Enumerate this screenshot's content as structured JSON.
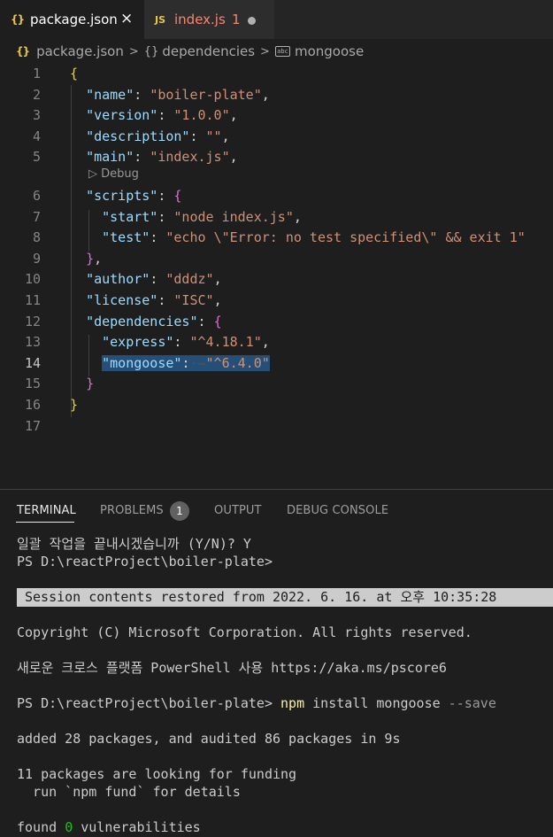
{
  "tabs": [
    {
      "icon": "{}",
      "label": "package.json",
      "close": "×"
    },
    {
      "icon": "JS",
      "label": "index.js",
      "problems": "1"
    }
  ],
  "breadcrumb": {
    "file": "package.json",
    "section": "dependencies",
    "item": "mongoose",
    "str_icon": "abc"
  },
  "editor": {
    "line_numbers": [
      "1",
      "2",
      "3",
      "4",
      "5",
      "6",
      "7",
      "8",
      "9",
      "10",
      "11",
      "12",
      "13",
      "14",
      "15",
      "16",
      "17"
    ],
    "codelens": "▷ Debug",
    "lines": {
      "l1": {
        "open": "{"
      },
      "l2": {
        "key": "\"name\"",
        "colon": ": ",
        "val": "\"boiler-plate\"",
        "comma": ","
      },
      "l3": {
        "key": "\"version\"",
        "colon": ": ",
        "val": "\"1.0.0\"",
        "comma": ","
      },
      "l4": {
        "key": "\"description\"",
        "colon": ": ",
        "val": "\"\"",
        "comma": ","
      },
      "l5": {
        "key": "\"main\"",
        "colon": ": ",
        "val": "\"index.js\"",
        "comma": ","
      },
      "l6": {
        "key": "\"scripts\"",
        "colon": ": ",
        "open": "{"
      },
      "l7": {
        "key": "\"start\"",
        "colon": ": ",
        "val": "\"node index.js\"",
        "comma": ","
      },
      "l8": {
        "key": "\"test\"",
        "colon": ": ",
        "val": "\"echo \\\"Error: no test specified\\\" && exit 1\""
      },
      "l9": {
        "close": "}",
        "comma": ","
      },
      "l10": {
        "key": "\"author\"",
        "colon": ": ",
        "val": "\"dddz\"",
        "comma": ","
      },
      "l11": {
        "key": "\"license\"",
        "colon": ": ",
        "val": "\"ISC\"",
        "comma": ","
      },
      "l12": {
        "key": "\"dependencies\"",
        "colon": ": ",
        "open": "{"
      },
      "l13": {
        "key": "\"express\"",
        "colon": ": ",
        "val": "\"^4.18.1\"",
        "comma": ","
      },
      "l14": {
        "key": "\"mongoose\"",
        "colon": ":",
        "val": "\"^6.4.0\""
      },
      "l15": {
        "close": "}"
      },
      "l16": {
        "close": "}"
      }
    }
  },
  "panel": {
    "tabs": [
      "TERMINAL",
      "PROBLEMS",
      "OUTPUT",
      "DEBUG CONSOLE"
    ],
    "problems_count": "1",
    "terminal": {
      "line1": "일괄 작업을 끝내시겠습니까 (Y/N)? Y",
      "line2": "PS D:\\reactProject\\boiler-plate>",
      "restored": "Session contents restored from 2022. 6. 16. at 오후 10:35:28",
      "copyright": "Copyright (C) Microsoft Corporation. All rights reserved.",
      "pscore": "새로운 크로스 플랫폼 PowerShell 사용 https://aka.ms/pscore6",
      "prompt": "PS D:\\reactProject\\boiler-plate> ",
      "cmd": "npm",
      "args": " install mongoose ",
      "flag": "--save",
      "added": "added 28 packages, and audited 86 packages in 9s",
      "funding1": "11 packages are looking for funding",
      "funding2": "  run `npm fund` for details",
      "found_pre": "found ",
      "found_num": "0",
      "found_post": " vulnerabilities"
    }
  }
}
